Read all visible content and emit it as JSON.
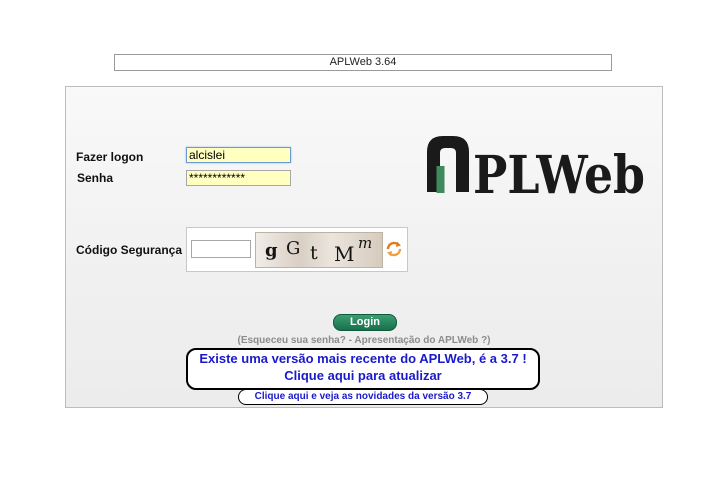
{
  "header": {
    "version_text": "APLWeb 3.64"
  },
  "logo": {
    "text": "PLWeb"
  },
  "form": {
    "login_label": "Fazer logon",
    "login_value": "alcislei",
    "password_label": "Senha",
    "password_value": "************",
    "security_label": "Código Segurança",
    "captcha_value": "",
    "captcha_chars": [
      "g",
      "G",
      "t",
      "M",
      "m"
    ],
    "login_button": "Login"
  },
  "links": {
    "forgot_password": "(Esqueceu sua senha?",
    "separator": " - ",
    "presentation": "Apresentação do APLWeb ?)",
    "update_line1": "Existe uma versão mais recente do APLWeb, é a 3.7 !",
    "update_line2": "Clique aqui para atualizar",
    "news": "Clique aqui e veja as novidades da versão 3.7"
  },
  "colors": {
    "logo_black": "#1a1a1a",
    "logo_green": "#3f8a5c",
    "login_button": "#1d7a52",
    "link_blue": "#1a1acc",
    "input_bg": "#ffffc0"
  }
}
